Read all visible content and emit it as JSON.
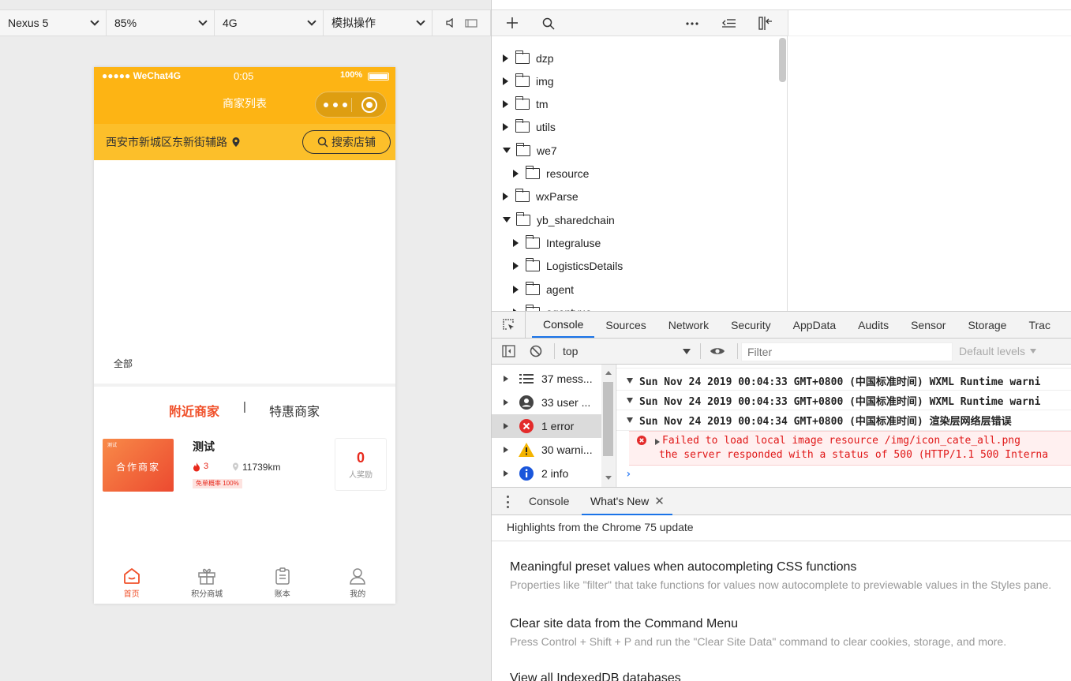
{
  "sim_toolbar": {
    "device": "Nexus 5",
    "zoom": "85%",
    "network": "4G",
    "operation": "模拟操作"
  },
  "phone": {
    "status": {
      "signal": "●●●●● WeChat4G",
      "time": "0:05",
      "battery": "100%"
    },
    "title": "商家列表",
    "address": "西安市新城区东新街辅路",
    "search_button": "搜索店铺",
    "category_all": "全部",
    "tabs": {
      "nearby": "附近商家",
      "divider": "|",
      "discount": "特惠商家"
    },
    "merchant": {
      "thumb_label": "合作商家",
      "thumb_corner": "测试",
      "name": "测试",
      "heat": "3",
      "distance": "11739km",
      "badge": "免单概率 100%",
      "reward_count": "0",
      "reward_label": "人奖励"
    },
    "tabbar": [
      {
        "label": "首页",
        "icon": "home-icon",
        "active": true
      },
      {
        "label": "积分商城",
        "icon": "gift-icon",
        "active": false
      },
      {
        "label": "账本",
        "icon": "clipboard-icon",
        "active": false
      },
      {
        "label": "我的",
        "icon": "user-icon",
        "active": false
      }
    ],
    "colors": {
      "header": "#fdb414",
      "accent": "#f0502a"
    }
  },
  "file_tree": [
    {
      "name": "dzp",
      "expanded": false,
      "depth": 0
    },
    {
      "name": "img",
      "expanded": false,
      "depth": 0
    },
    {
      "name": "tm",
      "expanded": false,
      "depth": 0
    },
    {
      "name": "utils",
      "expanded": false,
      "depth": 0
    },
    {
      "name": "we7",
      "expanded": true,
      "depth": 0
    },
    {
      "name": "resource",
      "expanded": false,
      "depth": 1
    },
    {
      "name": "wxParse",
      "expanded": false,
      "depth": 0
    },
    {
      "name": "yb_sharedchain",
      "expanded": true,
      "depth": 0
    },
    {
      "name": "Integraluse",
      "expanded": false,
      "depth": 1
    },
    {
      "name": "LogisticsDetails",
      "expanded": false,
      "depth": 1
    },
    {
      "name": "agent",
      "expanded": false,
      "depth": 1
    },
    {
      "name": "agentyue",
      "expanded": false,
      "depth": 1
    }
  ],
  "devtools_tabs": [
    "Console",
    "Sources",
    "Network",
    "Security",
    "AppData",
    "Audits",
    "Sensor",
    "Storage",
    "Trac"
  ],
  "console_toolbar": {
    "context": "top",
    "filter_placeholder": "Filter",
    "levels": "Default levels"
  },
  "console_sidebar": [
    {
      "icon": "list-icon",
      "label": "37 mess..."
    },
    {
      "icon": "user-circle-icon",
      "label": "33 user ..."
    },
    {
      "icon": "error-icon",
      "label": "1 error"
    },
    {
      "icon": "warning-icon",
      "label": "30 warni..."
    },
    {
      "icon": "info-icon",
      "label": "2 info"
    }
  ],
  "console_logs": [
    {
      "text": "Sun Nov 24 2019 00:04:33 GMT+0800 (中国标准时间) WXML Runtime warni"
    },
    {
      "text": "Sun Nov 24 2019 00:04:33 GMT+0800 (中国标准时间) WXML Runtime warni"
    },
    {
      "text": "Sun Nov 24 2019 00:04:34 GMT+0800 (中国标准时间) 渲染层网络层错误"
    }
  ],
  "console_error": {
    "line1": "Failed to load local image resource /img/icon_cate_all.png",
    "line2": "the server responded with a status of 500 (HTTP/1.1 500 Interna"
  },
  "drawer_tabs": {
    "console": "Console",
    "whats_new": "What's New"
  },
  "whats_new": {
    "header": "Highlights from the Chrome 75 update",
    "items": [
      {
        "title": "Meaningful preset values when autocompleting CSS functions",
        "desc": "Properties like \"filter\" that take functions for values now autocomplete to previewable values in the Styles pane."
      },
      {
        "title": "Clear site data from the Command Menu",
        "desc": "Press Control + Shift + P and run the \"Clear Site Data\" command to clear cookies, storage, and more."
      },
      {
        "title": "View all IndexedDB databases",
        "desc": ""
      }
    ]
  }
}
